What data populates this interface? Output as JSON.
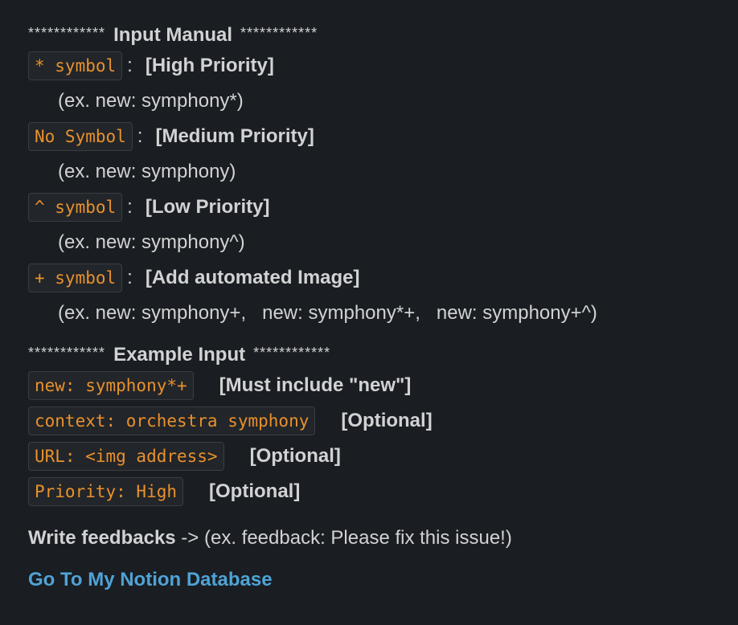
{
  "manual": {
    "stars": "************",
    "title": "Input Manual",
    "items": [
      {
        "symbol": "* symbol",
        "label": "[High Priority]",
        "example": "(ex. new: symphony*)"
      },
      {
        "symbol": "No Symbol",
        "label": "[Medium Priority]",
        "example": "(ex. new: symphony)"
      },
      {
        "symbol": "^ symbol",
        "label": "[Low Priority]",
        "example": "(ex. new: symphony^)"
      },
      {
        "symbol": "+ symbol",
        "label": "[Add automated Image]",
        "example": "(ex. new: symphony+,   new: symphony*+,   new: symphony+^)"
      }
    ]
  },
  "example": {
    "stars": "************",
    "title": "Example Input",
    "rows": [
      {
        "code": "new: symphony*+",
        "label": "[Must include \"new\"]"
      },
      {
        "code": "context: orchestra symphony",
        "label": "[Optional]"
      },
      {
        "code": "URL: <img address>",
        "label": "[Optional]"
      },
      {
        "code": "Priority: High",
        "label": "[Optional]"
      }
    ]
  },
  "feedback": {
    "label": "Write feedbacks",
    "text": " -> (ex. feedback: Please fix this issue!)"
  },
  "link": {
    "text": "Go To My Notion Database"
  },
  "colors": {
    "background": "#1a1d21",
    "text": "#d1d2d3",
    "code": "#e8912d",
    "link": "#4fa3d6"
  }
}
